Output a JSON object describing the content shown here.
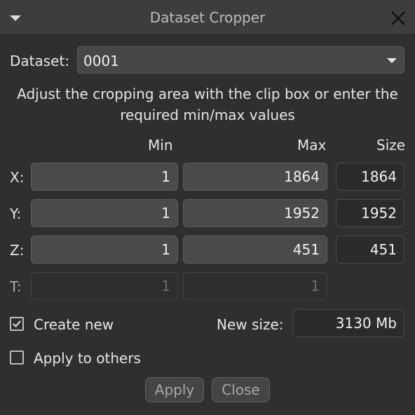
{
  "window": {
    "title": "Dataset Cropper"
  },
  "dataset": {
    "label": "Dataset:",
    "value": "0001"
  },
  "description": {
    "line1": "Adjust the cropping area with the clip box or enter the",
    "line2": "required min/max values"
  },
  "columns": {
    "min": "Min",
    "max": "Max",
    "size": "Size"
  },
  "axes": [
    {
      "label": "X:",
      "min": "1",
      "max": "1864",
      "size": "1864"
    },
    {
      "label": "Y:",
      "min": "1",
      "max": "1952",
      "size": "1952"
    },
    {
      "label": "Z:",
      "min": "1",
      "max": "451",
      "size": "451"
    },
    {
      "label": "T:",
      "min": "1",
      "max": "1",
      "size": ""
    }
  ],
  "options": {
    "create_new_label": "Create new",
    "create_new_checked": true,
    "apply_to_others_label": "Apply to others",
    "apply_to_others_checked": false
  },
  "new_size": {
    "label": "New size:",
    "value": "3130 Mb"
  },
  "buttons": {
    "apply": "Apply",
    "close": "Close"
  },
  "icons": {
    "menu": "chevron-down-icon",
    "close": "close-icon",
    "check": "check-icon"
  }
}
